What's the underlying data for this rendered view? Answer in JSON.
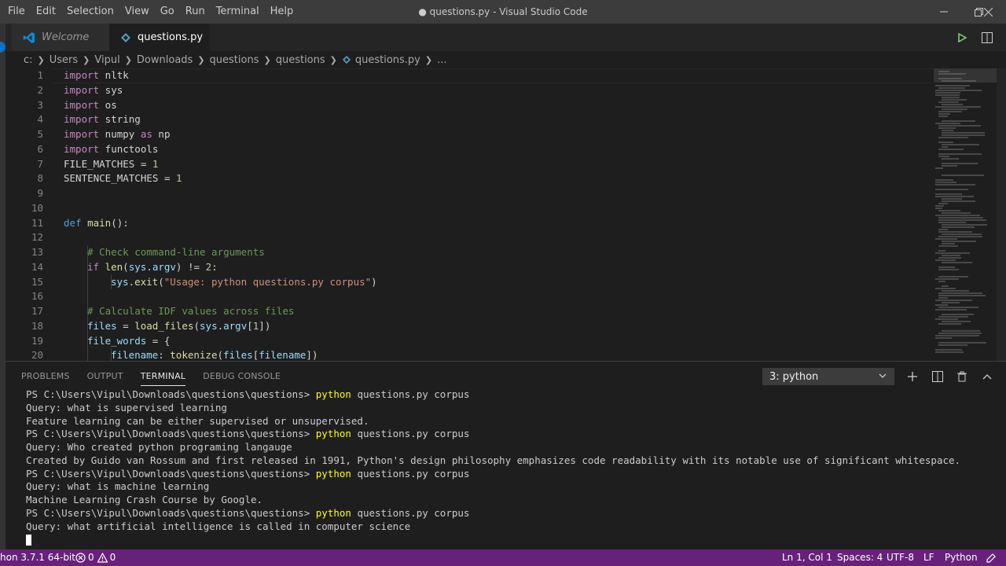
{
  "menu": [
    "File",
    "Edit",
    "Selection",
    "View",
    "Go",
    "Run",
    "Terminal",
    "Help"
  ],
  "window_title": "● questions.py - Visual Studio Code",
  "tabs": {
    "welcome": "Welcome",
    "questions": "questions.py"
  },
  "breadcrumb": [
    "c:",
    "Users",
    "Vipul",
    "Downloads",
    "questions",
    "questions",
    "questions.py",
    "..."
  ],
  "code_lines": [
    {
      "n": "1"
    },
    {
      "n": "2"
    },
    {
      "n": "3"
    },
    {
      "n": "4"
    },
    {
      "n": "5"
    },
    {
      "n": "6"
    },
    {
      "n": "7"
    },
    {
      "n": "8"
    },
    {
      "n": "9"
    },
    {
      "n": "10"
    },
    {
      "n": "11"
    },
    {
      "n": "12"
    },
    {
      "n": "13"
    },
    {
      "n": "14"
    },
    {
      "n": "15"
    },
    {
      "n": "16"
    },
    {
      "n": "17"
    },
    {
      "n": "18"
    },
    {
      "n": "19"
    },
    {
      "n": "20"
    }
  ],
  "code": {
    "l1": [
      "import",
      " nltk"
    ],
    "l2": [
      "import",
      " sys"
    ],
    "l3": [
      "import",
      " os"
    ],
    "l4": [
      "import",
      " string"
    ],
    "l5": [
      "import",
      " numpy ",
      "as",
      " np"
    ],
    "l6": [
      "import",
      " functools"
    ],
    "l7": [
      "FILE_MATCHES",
      " = ",
      "1"
    ],
    "l8": [
      "SENTENCE_MATCHES",
      " = ",
      "1"
    ],
    "l11": [
      "def",
      " ",
      "main",
      "():"
    ],
    "l13": "# Check command-line arguments",
    "l14": [
      "if",
      " ",
      "len",
      "(",
      "sys",
      ".",
      "argv",
      ") != ",
      "2",
      ":"
    ],
    "l15": [
      "sys",
      ".",
      "exit",
      "(",
      "\"Usage: python questions.py corpus\"",
      ")"
    ],
    "l17": "# Calculate IDF values across files",
    "l18": [
      "files",
      " = ",
      "load_files",
      "(",
      "sys",
      ".",
      "argv",
      "[",
      "1",
      "])"
    ],
    "l19": [
      "file_words",
      " = {"
    ],
    "l20": [
      "filename",
      ": ",
      "tokenize",
      "(",
      "files",
      "[",
      "filename",
      "])"
    ]
  },
  "panel": {
    "tabs": [
      "PROBLEMS",
      "OUTPUT",
      "TERMINAL",
      "DEBUG CONSOLE"
    ],
    "terminal_select": "3: python"
  },
  "terminal": {
    "prompt": "PS C:\\Users\\Vipul\\Downloads\\questions\\questions> ",
    "command": "python",
    "args": " questions.py corpus",
    "lines": [
      "Query: what is supervised learning",
      "Feature learning can be either supervised or unsupervised.",
      "Query: Who created python programing langauge",
      "Created by Guido van Rossum and first released in 1991, Python's design philosophy emphasizes code readability with its notable use of significant whitespace.",
      "Query: what is machine learning",
      "Machine Learning Crash Course by Google.",
      "Query: what artificial intelligence is called in computer science"
    ]
  },
  "statusbar": {
    "interpreter": "hon 3.7.1 64-bit",
    "errors": "0",
    "warnings": "0",
    "position": "Ln 1, Col 1",
    "spaces": "Spaces: 4",
    "encoding": "UTF-8",
    "eol": "LF",
    "language": "Python"
  },
  "colors": {
    "statusbar": "#68217a",
    "keyword": "#c586c0",
    "function": "#dcdcaa",
    "string": "#ce9178",
    "comment": "#6a9955",
    "number": "#b5cea8",
    "terminal_command": "#ffff00"
  }
}
